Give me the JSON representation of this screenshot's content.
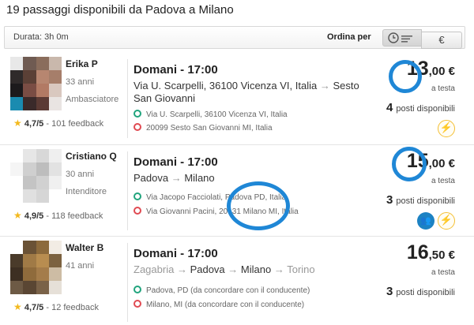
{
  "page": {
    "title": "19 passaggi disponibili da Padova a Milano"
  },
  "filter": {
    "duration": "Durata: 3h 0m",
    "sort_label": "Ordina per",
    "sort_time_icon": "clock-list-icon",
    "sort_price_label": "€"
  },
  "rides": [
    {
      "driver": {
        "name": "Erika P",
        "age": "33 anni",
        "role": "Ambasciatore",
        "rating": "4,7/5",
        "feedback": "- 101 feedback"
      },
      "when": "Domani - 17:00",
      "route": {
        "from": "Via U. Scarpelli, 36100 Vicenza VI, Italia",
        "arrow": "→",
        "to": "Sesto San Giovanni"
      },
      "pickup": "Via U. Scarpelli, 36100 Vicenza VI, Italia",
      "dropoff": "20099 Sesto San Giovanni MI, Italia",
      "price": {
        "int": "13",
        "dec": ",00 €"
      },
      "per_seat": "a testa",
      "seats": {
        "count": "4",
        "label": "posti disponibili"
      },
      "badges": [
        "lightning-icon"
      ]
    },
    {
      "driver": {
        "name": "Cristiano Q",
        "age": "30 anni",
        "role": "Intenditore",
        "rating": "4,9/5",
        "feedback": "- 118 feedback"
      },
      "when": "Domani - 17:00",
      "route": {
        "from": "Padova",
        "arrow": "→",
        "to": "Milano"
      },
      "pickup": "Via Jacopo Facciolati, Padova PD, Italia",
      "dropoff": "Via Giovanni Pacini, 20131 Milano MI, Italia",
      "price": {
        "int": "15",
        "dec": ",00 €"
      },
      "per_seat": "a testa",
      "seats": {
        "count": "3",
        "label": "posti disponibili"
      },
      "badges": [
        "ladies-only-icon",
        "lightning-icon"
      ]
    },
    {
      "driver": {
        "name": "Walter B",
        "age": "41 anni",
        "role": "",
        "rating": "4,7/5",
        "feedback": "- 12 feedback"
      },
      "when": "Domani - 17:00",
      "route": {
        "pre": "Zagabria",
        "pre_arrow": "→",
        "from": "Padova",
        "arrow": "→",
        "to": "Milano",
        "post_arrow": "→",
        "post": "Torino"
      },
      "pickup": "Padova, PD (da concordare con il conducente)",
      "dropoff": "Milano, MI (da concordare con il conducente)",
      "price": {
        "int": "16",
        "dec": ",50 €"
      },
      "per_seat": "a testa",
      "seats": {
        "count": "3",
        "label": "posti disponibili"
      },
      "badges": []
    }
  ],
  "colors": {
    "accent": "#1f87d6",
    "pickup_dot": "#21a47d",
    "dropoff_dot": "#e04a52",
    "star": "#f3b91d",
    "flash_badge": "#f4bf33"
  }
}
